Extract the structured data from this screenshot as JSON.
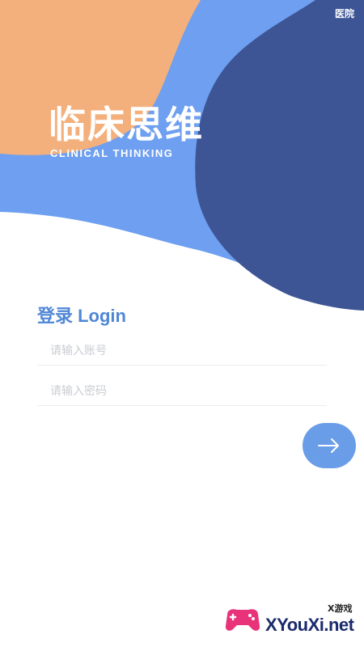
{
  "header": {
    "corner_label": "医院",
    "title": "临床思维",
    "subtitle": "CLINICAL THINKING"
  },
  "login": {
    "heading": "登录 Login",
    "account_placeholder": "请输入账号",
    "password_placeholder": "请输入密码",
    "submit_icon": "arrow-right-icon"
  },
  "watermark": {
    "text": "XYouXi.net",
    "sub": "X游戏"
  },
  "colors": {
    "orange": "#f4b07c",
    "light_blue": "#6e9ff0",
    "dark_blue": "#3d5595",
    "accent": "#4f87d6",
    "button": "#6a9de8"
  }
}
